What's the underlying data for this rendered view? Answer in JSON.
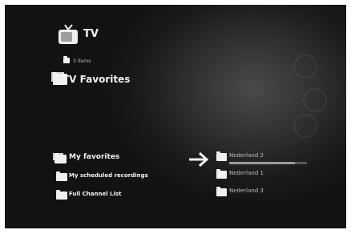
{
  "header": {
    "title": "TV",
    "item_count": "3 items",
    "section_title": "TV Favorites"
  },
  "menu": {
    "items": [
      {
        "label": "My favorites",
        "selected": true
      },
      {
        "label": "My scheduled recordings",
        "selected": false
      },
      {
        "label": "Full Channel List",
        "selected": false
      }
    ]
  },
  "channels": {
    "items": [
      {
        "label": "Nederland 2",
        "progress": 0.85
      },
      {
        "label": "Nederland 1"
      },
      {
        "label": "Nederland 3"
      }
    ]
  },
  "icons": {
    "tv": "tv-icon",
    "folder": "folder-icon",
    "arrow": "arrow-right-icon"
  }
}
